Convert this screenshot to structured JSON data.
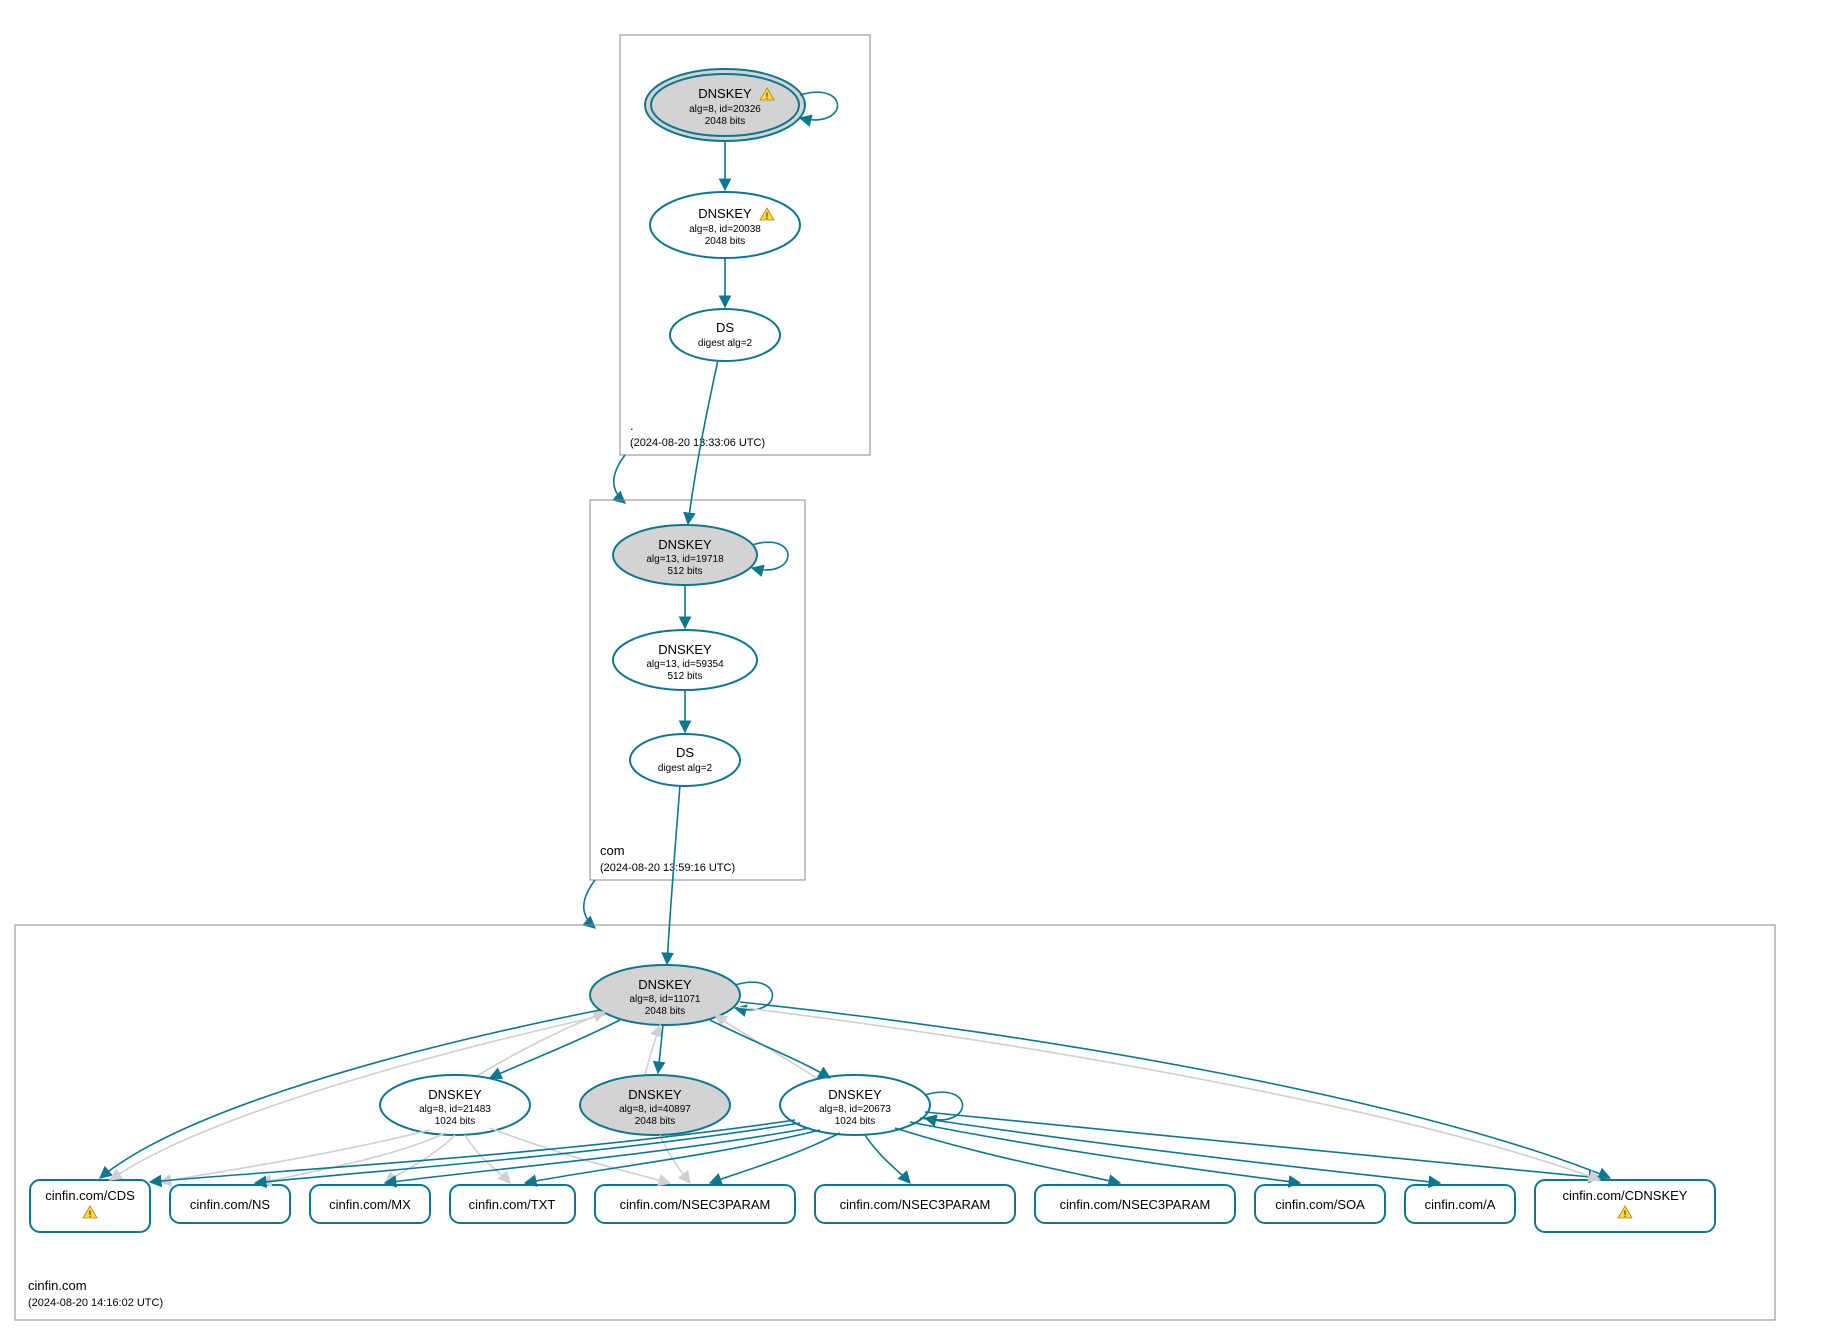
{
  "zones": {
    "root": {
      "label": ".",
      "timestamp": "(2024-08-20 13:33:06 UTC)",
      "dnskey_ksk": {
        "title": "DNSKEY",
        "sub1": "alg=8, id=20326",
        "sub2": "2048 bits",
        "warn": true
      },
      "dnskey_zsk": {
        "title": "DNSKEY",
        "sub1": "alg=8, id=20038",
        "sub2": "2048 bits",
        "warn": true
      },
      "ds": {
        "title": "DS",
        "sub1": "digest alg=2"
      }
    },
    "com": {
      "label": "com",
      "timestamp": "(2024-08-20 13:59:16 UTC)",
      "dnskey_ksk": {
        "title": "DNSKEY",
        "sub1": "alg=13, id=19718",
        "sub2": "512 bits"
      },
      "dnskey_zsk": {
        "title": "DNSKEY",
        "sub1": "alg=13, id=59354",
        "sub2": "512 bits"
      },
      "ds": {
        "title": "DS",
        "sub1": "digest alg=2"
      }
    },
    "cinfin": {
      "label": "cinfin.com",
      "timestamp": "(2024-08-20 14:16:02 UTC)",
      "dnskey_ksk": {
        "title": "DNSKEY",
        "sub1": "alg=8, id=11071",
        "sub2": "2048 bits"
      },
      "dnskey_a": {
        "title": "DNSKEY",
        "sub1": "alg=8, id=21483",
        "sub2": "1024 bits"
      },
      "dnskey_b": {
        "title": "DNSKEY",
        "sub1": "alg=8, id=40897",
        "sub2": "2048 bits"
      },
      "dnskey_c": {
        "title": "DNSKEY",
        "sub1": "alg=8, id=20673",
        "sub2": "1024 bits"
      },
      "rr": {
        "cds": {
          "label": "cinfin.com/CDS",
          "warn": true
        },
        "ns": {
          "label": "cinfin.com/NS"
        },
        "mx": {
          "label": "cinfin.com/MX"
        },
        "txt": {
          "label": "cinfin.com/TXT"
        },
        "n3p1": {
          "label": "cinfin.com/NSEC3PARAM"
        },
        "n3p2": {
          "label": "cinfin.com/NSEC3PARAM"
        },
        "n3p3": {
          "label": "cinfin.com/NSEC3PARAM"
        },
        "soa": {
          "label": "cinfin.com/SOA"
        },
        "a": {
          "label": "cinfin.com/A"
        },
        "cdnskey": {
          "label": "cinfin.com/CDNSKEY",
          "warn": true
        }
      }
    }
  },
  "colors": {
    "accent": "#0d7790",
    "ksk_fill": "#d3d3d3"
  }
}
